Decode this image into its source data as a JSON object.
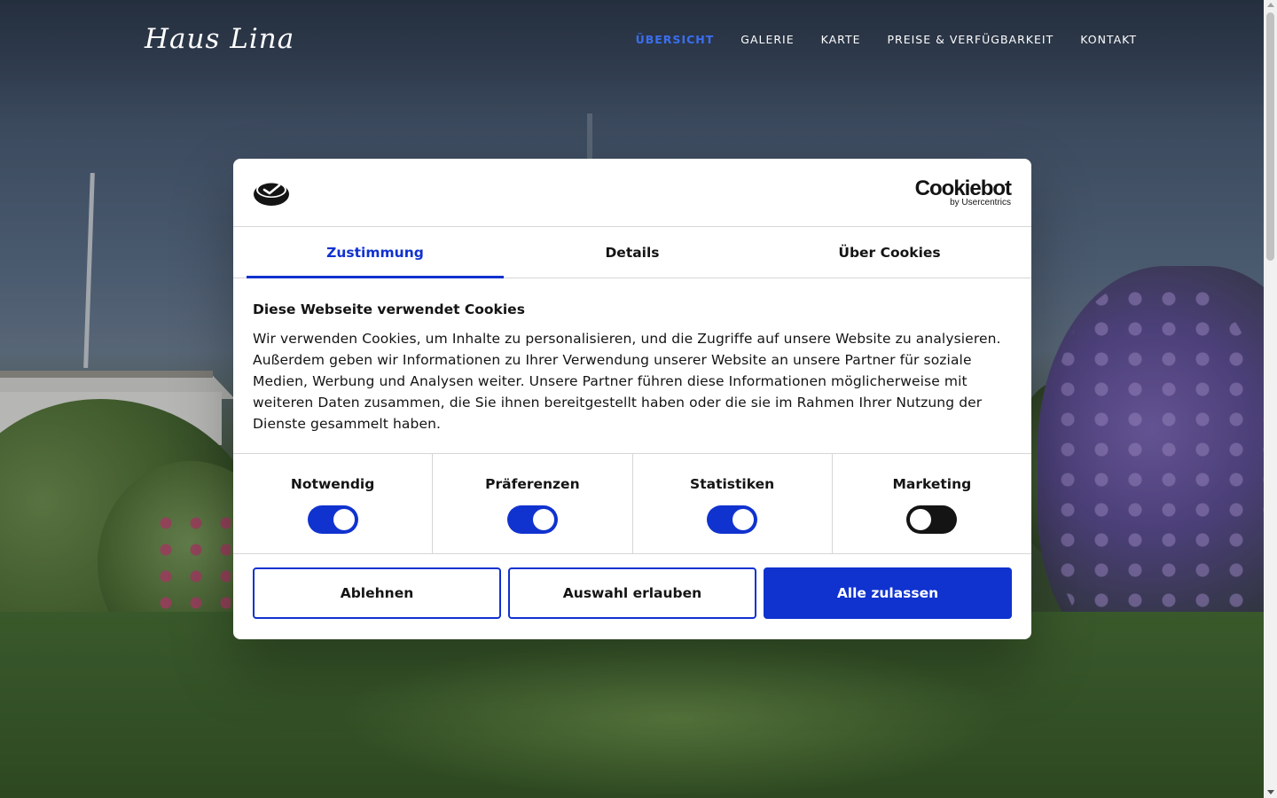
{
  "site": {
    "logo": "Haus Lina",
    "nav": [
      {
        "label": "ÜBERSICHT",
        "active": true
      },
      {
        "label": "GALERIE",
        "active": false
      },
      {
        "label": "KARTE",
        "active": false
      },
      {
        "label": "PREISE & VERFÜGBARKEIT",
        "active": false
      },
      {
        "label": "KONTAKT",
        "active": false
      }
    ]
  },
  "cookie_dialog": {
    "brand": {
      "name": "Cookiebot",
      "sub": "by Usercentrics"
    },
    "tabs": [
      {
        "label": "Zustimmung",
        "active": true
      },
      {
        "label": "Details",
        "active": false
      },
      {
        "label": "Über Cookies",
        "active": false
      }
    ],
    "heading": "Diese Webseite verwendet Cookies",
    "text": "Wir verwenden Cookies, um Inhalte zu personalisieren, und die Zugriffe auf unsere Website zu analysieren. Außerdem geben wir Informationen zu Ihrer Verwendung unserer Website an unsere Partner für soziale Medien, Werbung und Analysen weiter. Unsere Partner führen diese Informationen möglicherweise mit weiteren Daten zusammen, die Sie ihnen bereitgestellt haben oder die sie im Rahmen Ihrer Nutzung der Dienste gesammelt haben.",
    "categories": [
      {
        "label": "Notwendig",
        "enabled": true
      },
      {
        "label": "Präferenzen",
        "enabled": true
      },
      {
        "label": "Statistiken",
        "enabled": true
      },
      {
        "label": "Marketing",
        "enabled": false
      }
    ],
    "buttons": {
      "decline": "Ablehnen",
      "allow_selection": "Auswahl erlauben",
      "allow_all": "Alle zulassen"
    }
  },
  "colors": {
    "accent": "#1032cf",
    "nav_active": "#3a6ff0",
    "text": "#141414"
  }
}
